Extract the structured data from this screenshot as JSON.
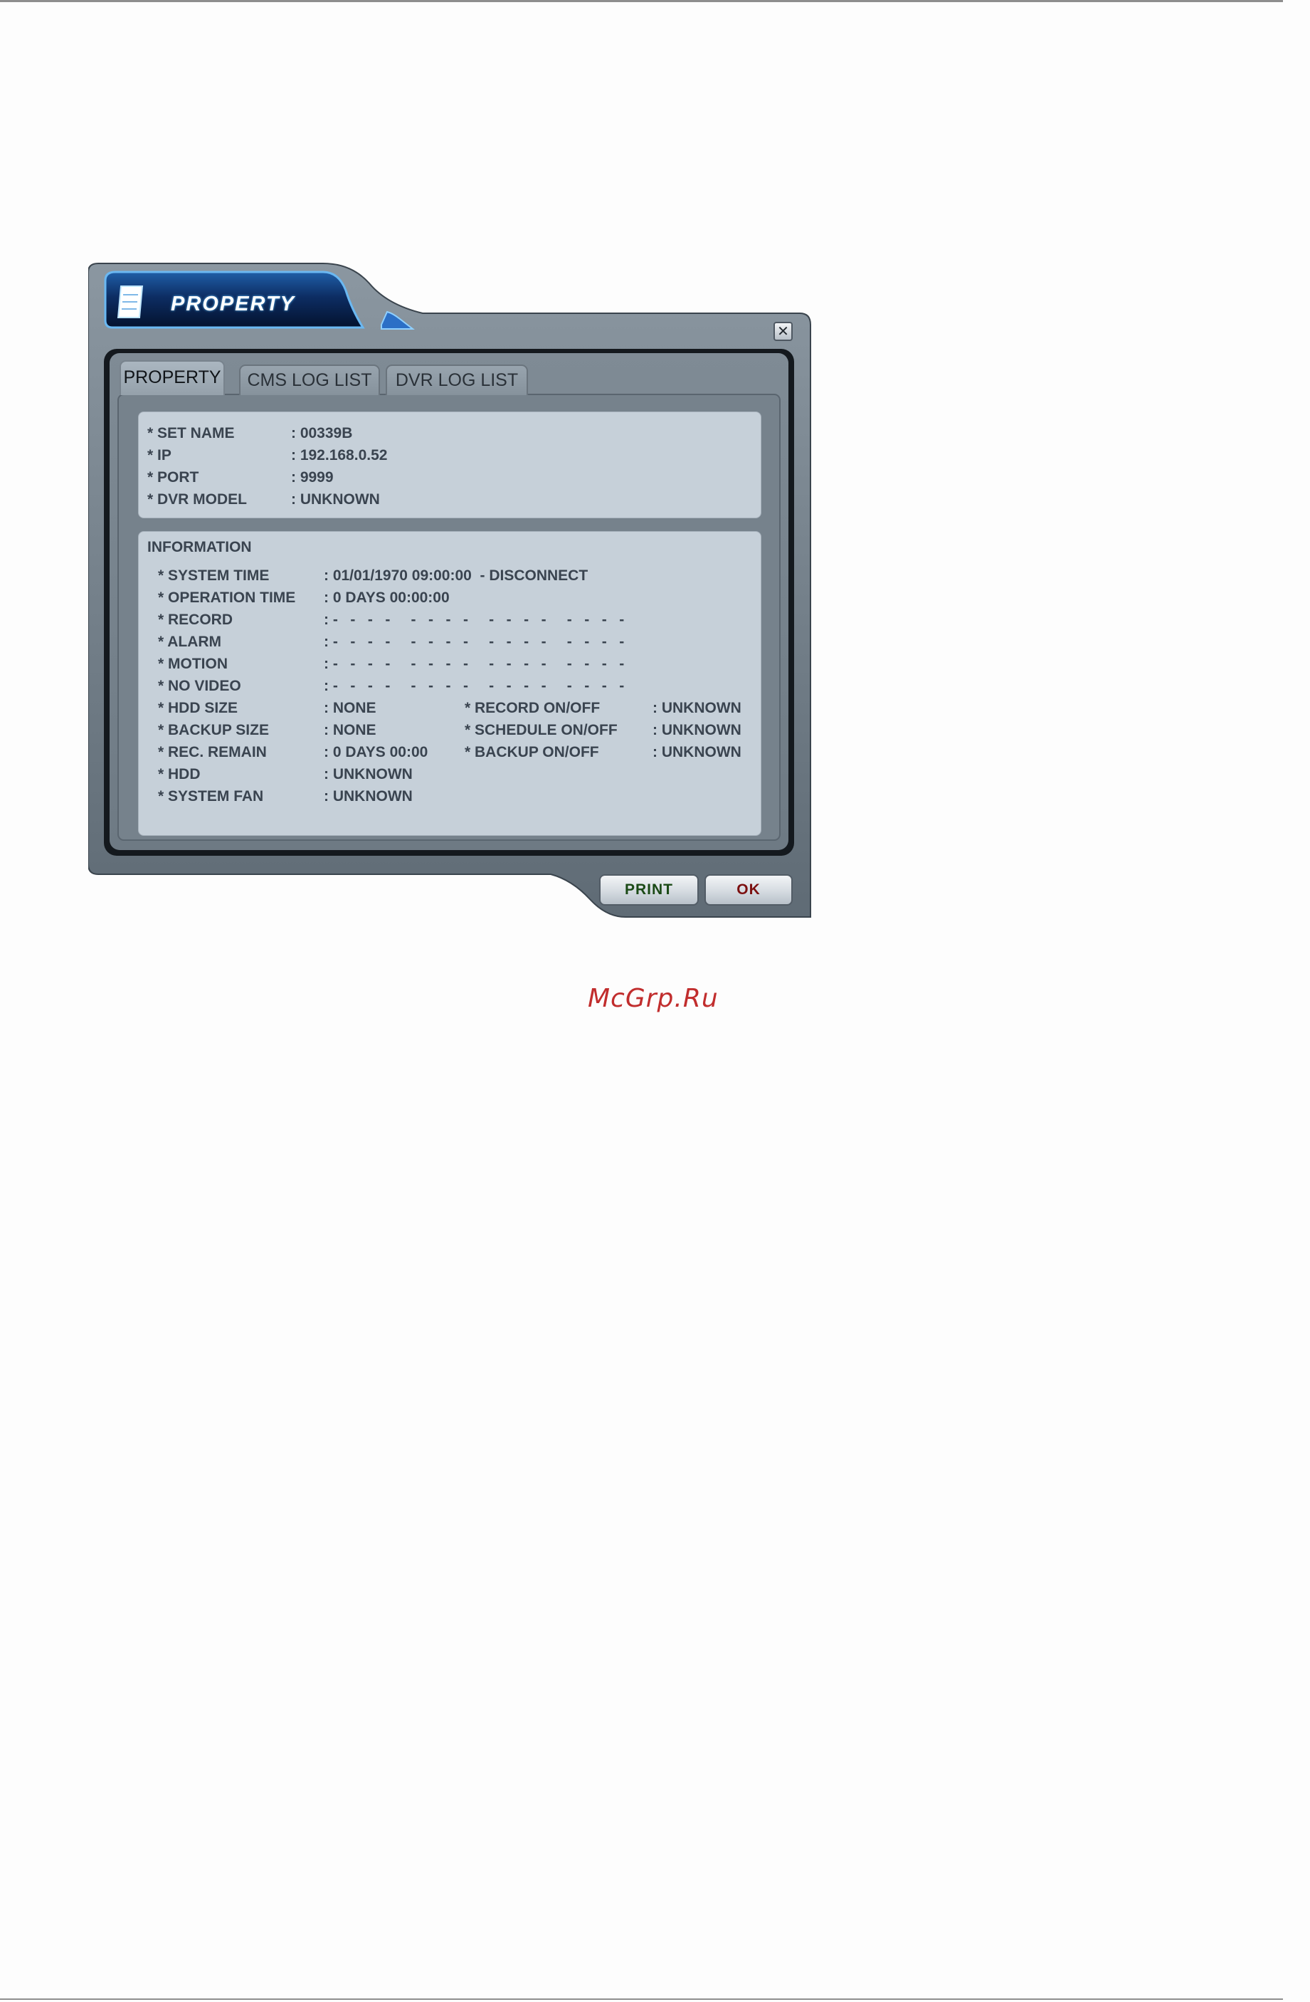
{
  "window": {
    "title": "PROPERTY",
    "close_symbol": "✕",
    "icons": {
      "title": "notepad-icon",
      "close": "close-icon"
    }
  },
  "tabs": [
    {
      "label": "PROPERTY",
      "active": true
    },
    {
      "label": "CMS LOG LIST",
      "active": false
    },
    {
      "label": "DVR LOG LIST",
      "active": false
    }
  ],
  "device": {
    "set_name": {
      "label": "* SET NAME",
      "value": ": 00339B"
    },
    "ip": {
      "label": "* IP",
      "value": ": 192.168.0.52"
    },
    "port": {
      "label": "* PORT",
      "value": ": 9999"
    },
    "model": {
      "label": "* DVR MODEL",
      "value": ": UNKNOWN"
    }
  },
  "information": {
    "heading": "INFORMATION",
    "system_time": {
      "label": "* SYSTEM TIME",
      "value": ": 01/01/1970 09:00:00  - DISCONNECT"
    },
    "operation_time": {
      "label": "* OPERATION TIME",
      "value": ": 0 DAYS 00:00:00"
    },
    "record": {
      "label": "* RECORD",
      "value": ": -   -   -   -     -   -   -   -     -   -   -   -     -   -   -   -"
    },
    "alarm": {
      "label": "* ALARM",
      "value": ": -   -   -   -     -   -   -   -     -   -   -   -     -   -   -   -"
    },
    "motion": {
      "label": "* MOTION",
      "value": ": -   -   -   -     -   -   -   -     -   -   -   -     -   -   -   -"
    },
    "no_video": {
      "label": "* NO VIDEO",
      "value": ": -   -   -   -     -   -   -   -     -   -   -   -     -   -   -   -"
    },
    "hdd_size": {
      "label": "* HDD SIZE",
      "value": ": NONE"
    },
    "backup_size": {
      "label": "* BACKUP SIZE",
      "value": ": NONE"
    },
    "rec_remain": {
      "label": "* REC. REMAIN",
      "value": ": 0 DAYS 00:00"
    },
    "hdd": {
      "label": "* HDD",
      "value": ": UNKNOWN"
    },
    "system_fan": {
      "label": "* SYSTEM FAN",
      "value": ": UNKNOWN"
    },
    "record_onoff": {
      "label": "* RECORD ON/OFF",
      "value": ": UNKNOWN"
    },
    "schedule_onoff": {
      "label": "* SCHEDULE ON/OFF",
      "value": ": UNKNOWN"
    },
    "backup_onoff": {
      "label": "* BACKUP ON/OFF",
      "value": ": UNKNOWN"
    }
  },
  "buttons": {
    "print": "PRINT",
    "ok": "OK"
  },
  "watermark": "McGrp.Ru",
  "colors": {
    "title_bar": "#0c2a5a",
    "frame": "#6b7883",
    "panel": "#c6d0d9",
    "watermark": "#c12d2d"
  }
}
